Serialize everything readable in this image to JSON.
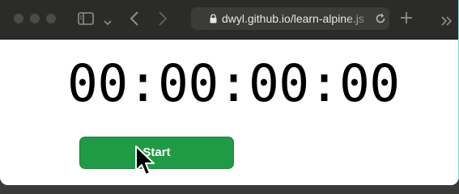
{
  "browser": {
    "url": "dwyl.github.io/learn-alpine.js"
  },
  "page": {
    "timer_display": "00:00:00:00",
    "start_button_label": "Start"
  },
  "colors": {
    "start_button": "#1f9a45",
    "titlebar": "#2b2b29",
    "address_bar": "#3b3b39"
  },
  "icons": [
    "sidebar-icon",
    "chevron-down-icon",
    "back-icon",
    "forward-icon",
    "lock-icon",
    "reload-icon",
    "new-tab-icon",
    "overflow-icon",
    "mouse-cursor-icon"
  ]
}
